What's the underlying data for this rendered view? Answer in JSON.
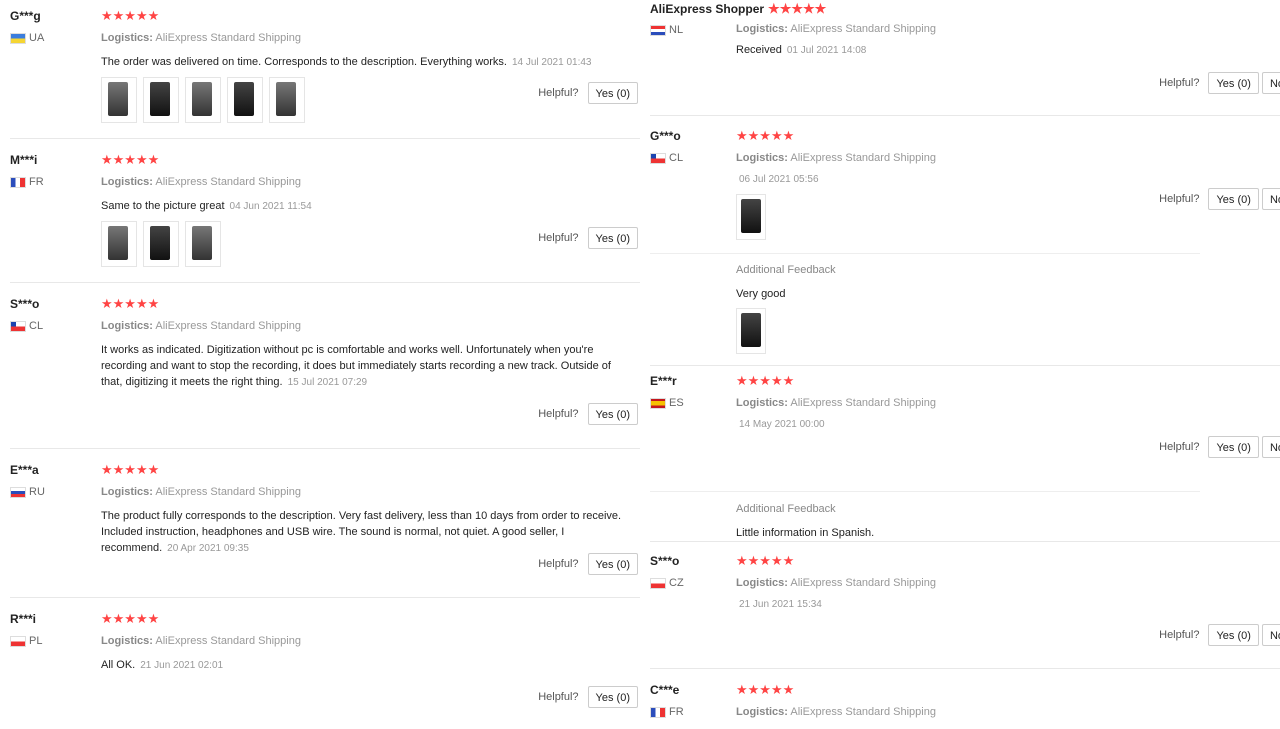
{
  "ui": {
    "helpful": "Helpful?",
    "logistics_label": "Logistics:",
    "additional_feedback": "Additional Feedback",
    "stars": "★★★★★"
  },
  "left": [
    {
      "user": "G***g",
      "country": "UA",
      "logistics": "AliExpress Standard Shipping",
      "text": "The order was delivered on time. Corresponds to the description. Everything works.",
      "date": "14 Jul 2021 01:43",
      "yes": "Yes (0)",
      "photos": 5
    },
    {
      "user": "M***i",
      "country": "FR",
      "logistics": "AliExpress Standard Shipping",
      "text": "Same to the picture great",
      "date": "04 Jun 2021 11:54",
      "yes": "Yes (0)",
      "photos": 3
    },
    {
      "user": "S***o",
      "country": "CL",
      "logistics": "AliExpress Standard Shipping",
      "text": "It works as indicated. Digitization without pc is comfortable and works well. Unfortunately when you're recording and want to stop the recording, it does but immediately starts recording a new track. Outside of that, digitizing it meets the right thing.",
      "date": "15 Jul 2021 07:29",
      "yes": "Yes (0)"
    },
    {
      "user": "E***a",
      "country": "RU",
      "logistics": "AliExpress Standard Shipping",
      "text": "The product fully corresponds to the description. Very fast delivery, less than 10 days from order to receive. Included instruction, headphones and USB wire. The sound is normal, not quiet. A good seller, I recommend.",
      "date": "20 Apr 2021 09:35",
      "yes": "Yes (0)"
    },
    {
      "user": "R***i",
      "country": "PL",
      "logistics": "AliExpress Standard Shipping",
      "text": "All OK.",
      "date": "21 Jun 2021 02:01",
      "yes": "Yes (0)"
    }
  ],
  "right": [
    {
      "user": "AliExpress Shopper",
      "country": "NL",
      "text": "Received",
      "date": "01 Jul 2021 14:08",
      "yes": "Yes (0)",
      "no": "No"
    },
    {
      "user": "G***o",
      "country": "CL",
      "logistics": "AliExpress Standard Shipping",
      "date": "06 Jul 2021 05:56",
      "yes": "Yes (0)",
      "no": "No",
      "additional": "Very good"
    },
    {
      "user": "E***r",
      "country": "ES",
      "logistics": "AliExpress Standard Shipping",
      "date": "14 May 2021 00:00",
      "yes": "Yes (0)",
      "no": "No",
      "additional": "Little information in Spanish."
    },
    {
      "user": "S***o",
      "country": "CZ",
      "logistics": "AliExpress Standard Shipping",
      "date": "21 Jun 2021 15:34",
      "yes": "Yes (0)",
      "no": "No"
    },
    {
      "user": "C***e",
      "country": "FR",
      "logistics": "AliExpress Standard Shipping"
    }
  ]
}
